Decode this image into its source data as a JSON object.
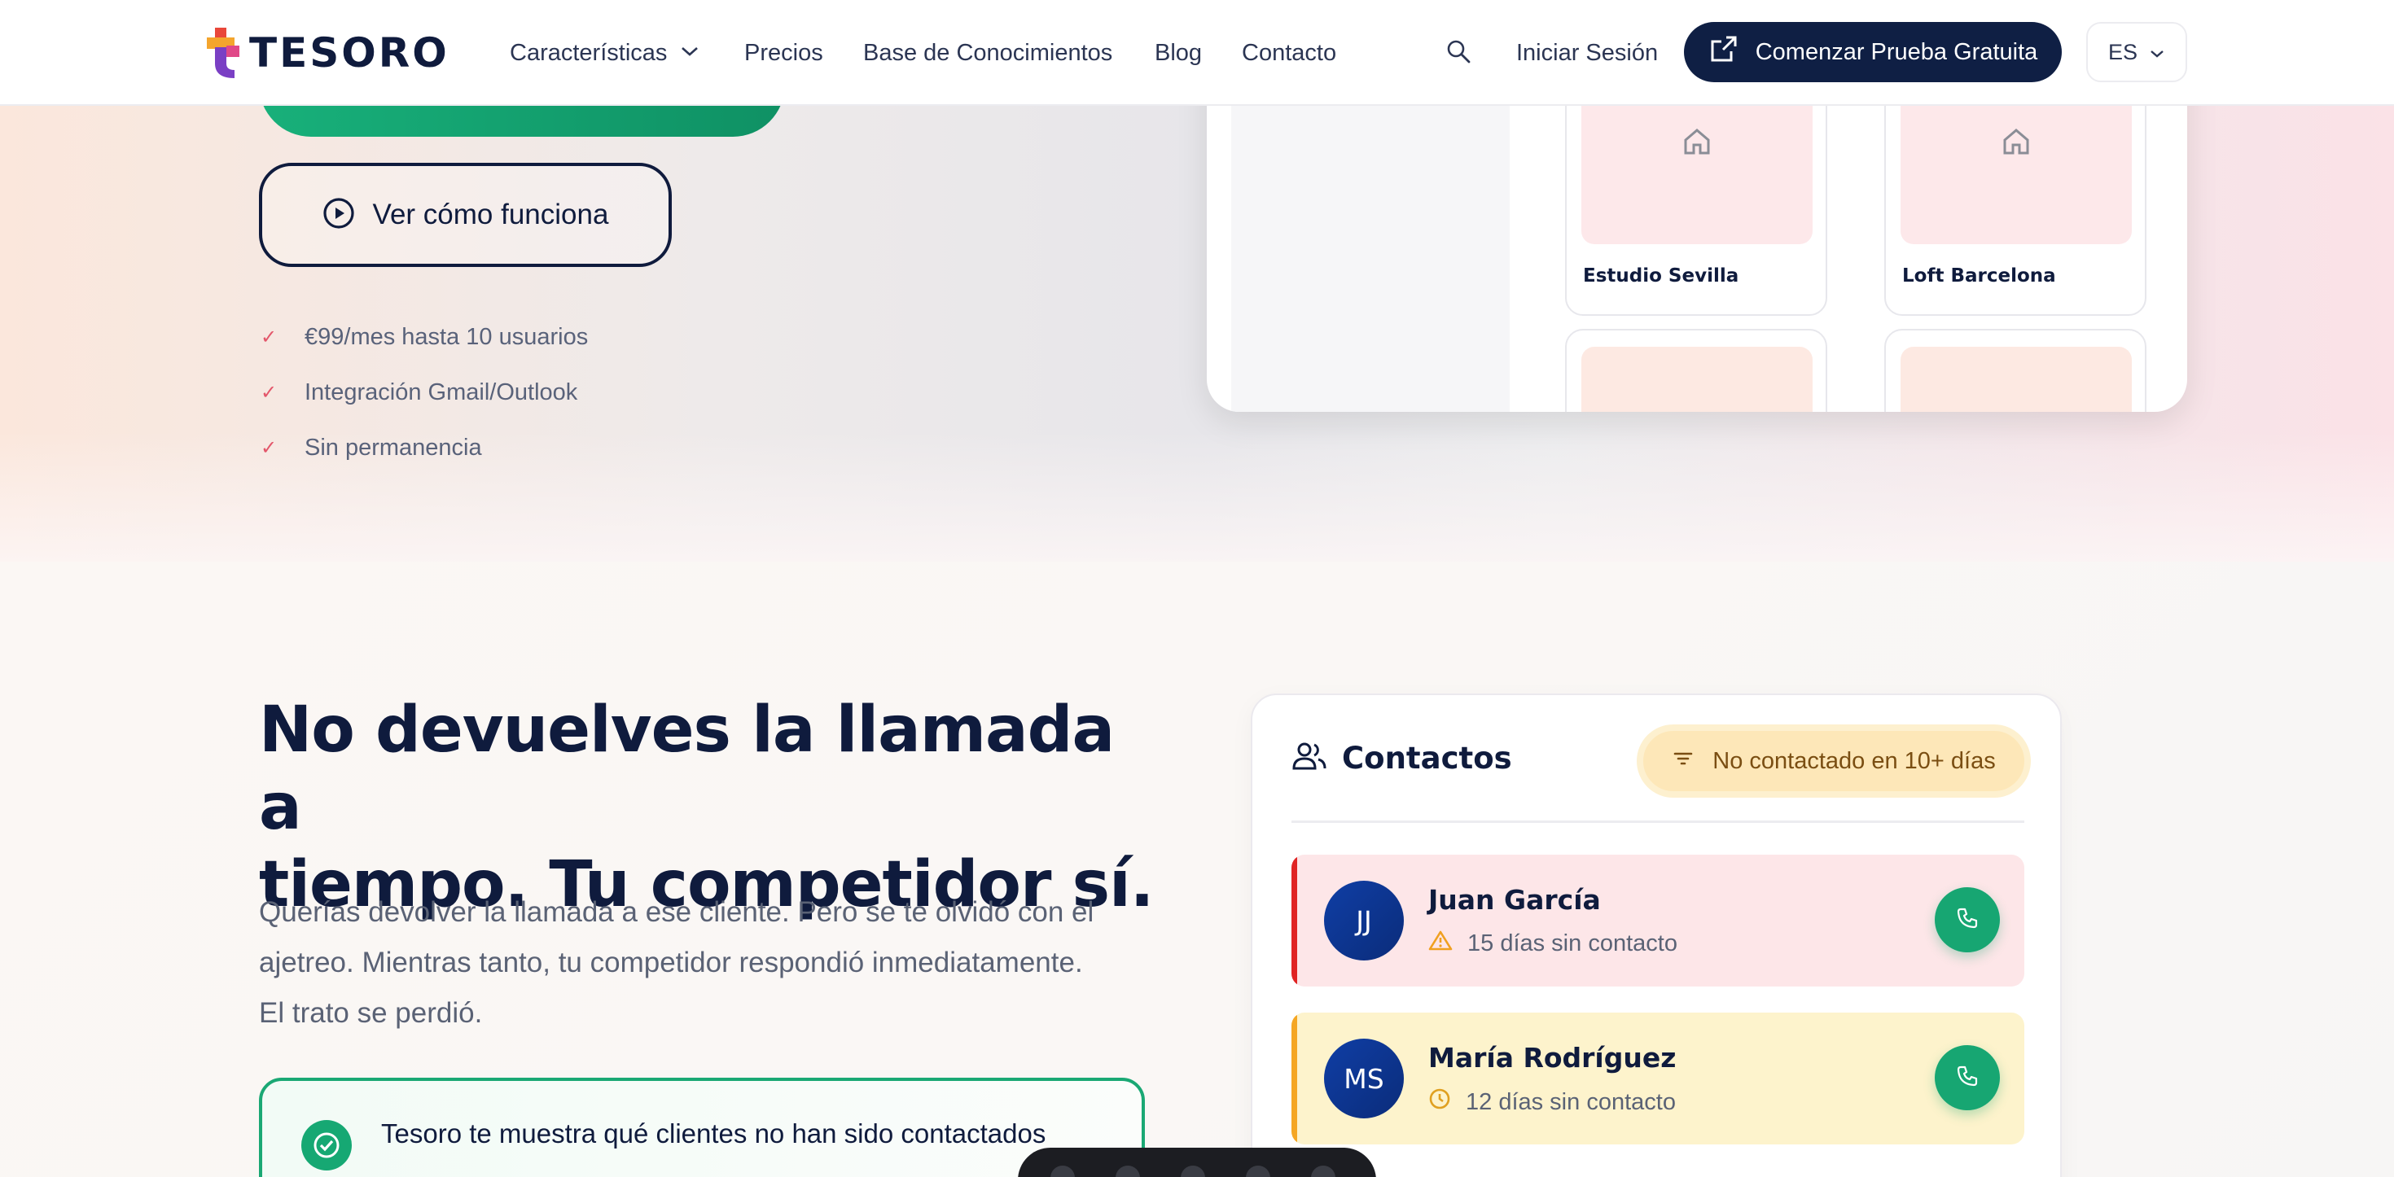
{
  "header": {
    "logo_text": "TESORO",
    "nav": [
      {
        "label": "Características",
        "has_dropdown": true
      },
      {
        "label": "Precios"
      },
      {
        "label": "Base de Conocimientos"
      },
      {
        "label": "Blog"
      },
      {
        "label": "Contacto"
      }
    ],
    "signin_label": "Iniciar Sesión",
    "trial_label": "Comenzar Prueba Gratuita",
    "language": "ES"
  },
  "hero": {
    "watch_button": "Ver cómo funciona",
    "checks": [
      "€99/mes hasta 10 usuarios",
      "Integración Gmail/Outlook",
      "Sin permanencia"
    ],
    "mock_cards": [
      "Estudio Sevilla",
      "Loft Barcelona"
    ]
  },
  "section2": {
    "heading_line1": "No devuelves la llamada a",
    "heading_line2": "tiempo. Tu competidor sí.",
    "paragraph_line1": "Querías devolver la llamada a ese cliente. Pero se te olvidó con el",
    "paragraph_line2": "ajetreo. Mientras tanto, tu competidor respondió inmediatamente.",
    "paragraph_line3": "El trato se perdió.",
    "solution_text": "Tesoro te muestra qué clientes no han sido contactados"
  },
  "contacts_panel": {
    "title": "Contactos",
    "filter_label": "No contactado en 10+ días",
    "rows": [
      {
        "initials": "JJ",
        "name": "Juan García",
        "status": "15 días sin contacto",
        "level": "warning-red"
      },
      {
        "initials": "MS",
        "name": "María Rodríguez",
        "status": "12 días sin contacto",
        "level": "warning-yellow"
      }
    ]
  },
  "colors": {
    "brand_navy": "#0f1f44",
    "accent_green": "#17a672",
    "alert_red": "#e02424",
    "alert_yellow": "#f5a623"
  }
}
